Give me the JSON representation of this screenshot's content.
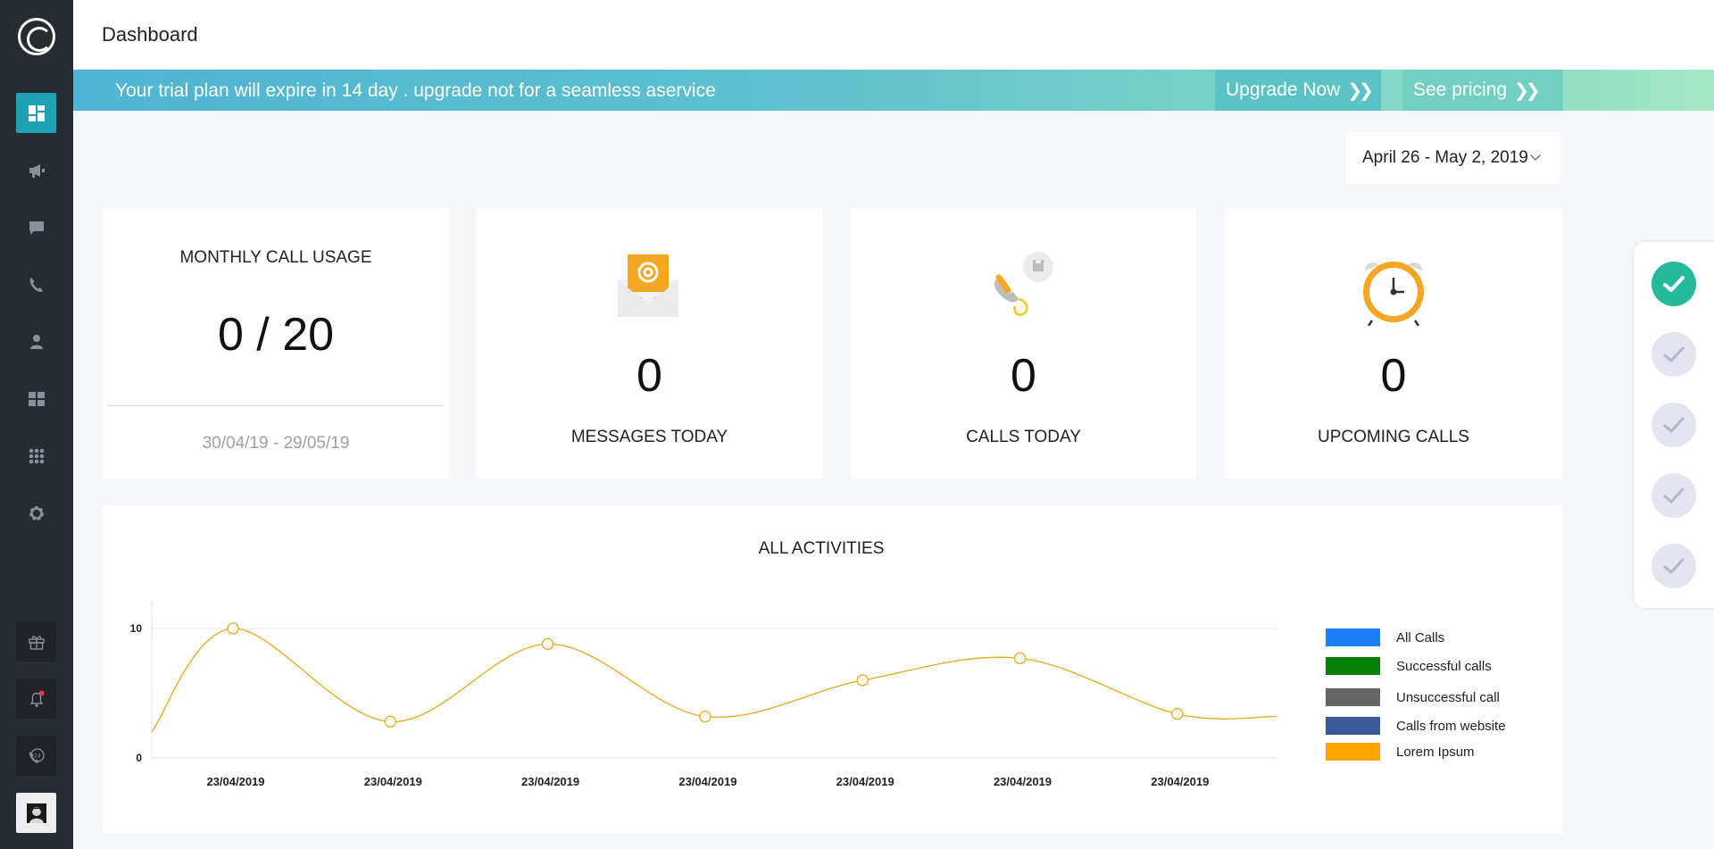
{
  "sidebar": {
    "nav": [
      {
        "icon": "dashboard-icon",
        "active": true
      },
      {
        "icon": "megaphone-icon"
      },
      {
        "icon": "chat-icon"
      },
      {
        "icon": "phone-icon"
      },
      {
        "icon": "user-icon"
      },
      {
        "icon": "widgets-icon"
      },
      {
        "icon": "apps-grid-icon"
      },
      {
        "icon": "gear-icon"
      }
    ],
    "bottom": [
      {
        "icon": "gift-icon"
      },
      {
        "icon": "bell-icon",
        "badge": "1"
      },
      {
        "icon": "phone-24-icon"
      },
      {
        "icon": "avatar"
      }
    ]
  },
  "header": {
    "title": "Dashboard"
  },
  "banner": {
    "text": "Your trial plan will expire in 14 day . upgrade  not for a seamless aservice",
    "upgrade_label": "Upgrade Now",
    "pricing_label": "See pricing"
  },
  "date_range": "April 26 - May 2, 2019",
  "cards": {
    "usage": {
      "label": "MONTHLY CALL USAGE",
      "value": "0 / 20",
      "range": "30/04/19 - 29/05/19"
    },
    "messages": {
      "value": "0",
      "label": "MESSAGES TODAY",
      "icon": "email-icon"
    },
    "calls": {
      "value": "0",
      "label": "CALLS TODAY",
      "icon": "phone-call-icon"
    },
    "upcoming": {
      "value": "0",
      "label": "UPCOMING CALLS",
      "icon": "alarm-clock-icon"
    }
  },
  "chart_data": {
    "type": "line",
    "title": "ALL ACTIVITIES",
    "xlabel": "",
    "ylabel": "",
    "y_ticks": [
      "0",
      "10"
    ],
    "ylim": [
      0,
      10
    ],
    "categories": [
      "23/04/2019",
      "23/04/2019",
      "23/04/2019",
      "23/04/2019",
      "23/04/2019",
      "23/04/2019",
      "23/04/2019"
    ],
    "series": [
      {
        "name": "Lorem Ipsum",
        "color": "#e8a81a",
        "values": [
          10,
          2.8,
          8.8,
          3.2,
          6.0,
          7.7,
          3.4
        ]
      }
    ],
    "legend": [
      {
        "label": "All Calls",
        "color": "#1e7ff5"
      },
      {
        "label": "Successful calls",
        "color": "#068008"
      },
      {
        "label": "Unsuccessful call",
        "color": "#666666"
      },
      {
        "label": "Calls from website",
        "color": "#3b5998"
      },
      {
        "label": "Lorem Ipsum",
        "color": "#ffa500"
      }
    ],
    "legend_position": "right",
    "grid": true
  },
  "checklist": [
    {
      "done": true
    },
    {
      "done": false
    },
    {
      "done": false
    },
    {
      "done": false
    },
    {
      "done": false
    }
  ]
}
